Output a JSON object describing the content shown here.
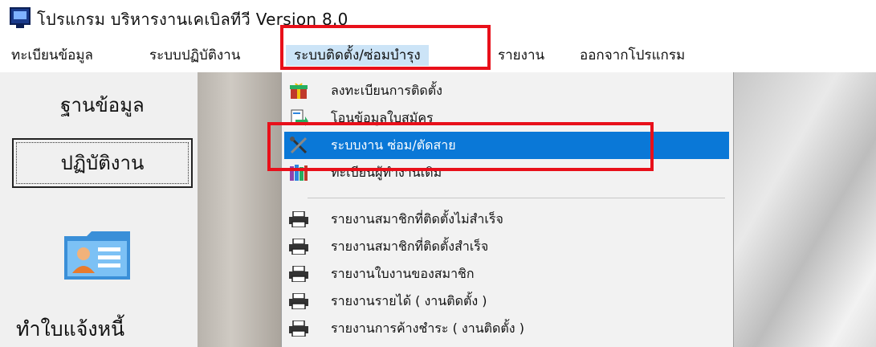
{
  "window": {
    "title": "โปรแกรม บริหารงานเคเบิลทีวี Version 8.0"
  },
  "menubar": {
    "items": [
      {
        "label": "ทะเบียนข้อมูล"
      },
      {
        "label": "ระบบปฏิบัติงาน"
      },
      {
        "label": "ระบบติดตั้ง/ซ่อมบำรุง"
      },
      {
        "label": "รายงาน"
      },
      {
        "label": "ออกจากโปรแกรม"
      }
    ]
  },
  "sidebar": {
    "buttons": [
      {
        "label": "ฐานข้อมูล"
      },
      {
        "label": "ปฏิบัติงาน"
      }
    ],
    "shortcut_label": "ทำใบแจ้งหนี้",
    "shortcut_icon": "folder-user-icon"
  },
  "dropdown": {
    "items": [
      {
        "label": "ลงทะเบียนการติดตั้ง",
        "icon": "gift-icon"
      },
      {
        "label": "โอนข้อมูลใบสมัคร",
        "icon": "document-transfer-icon"
      },
      {
        "label": "ระบบงาน ซ่อม/ตัดสาย",
        "icon": "tools-icon"
      },
      {
        "label": "ทะเบียนผู้ทำงานเดิม",
        "icon": "books-icon"
      },
      {
        "label": "รายงานสมาชิกที่ติดตั้งไม่สำเร็จ",
        "icon": "printer-icon"
      },
      {
        "label": "รายงานสมาชิกที่ติดตั้งสำเร็จ",
        "icon": "printer-icon"
      },
      {
        "label": "รายงานใบงานของสมาชิก",
        "icon": "printer-icon"
      },
      {
        "label": "รายงานรายได้ ( งานติดตั้ง )",
        "icon": "printer-icon"
      },
      {
        "label": "รายงานการค้างชำระ ( งานติดตั้ง )",
        "icon": "printer-icon"
      }
    ]
  },
  "colors": {
    "highlight": "#0a78d7",
    "menu_active": "#cce4f7",
    "annotation_red": "#e8101a"
  }
}
